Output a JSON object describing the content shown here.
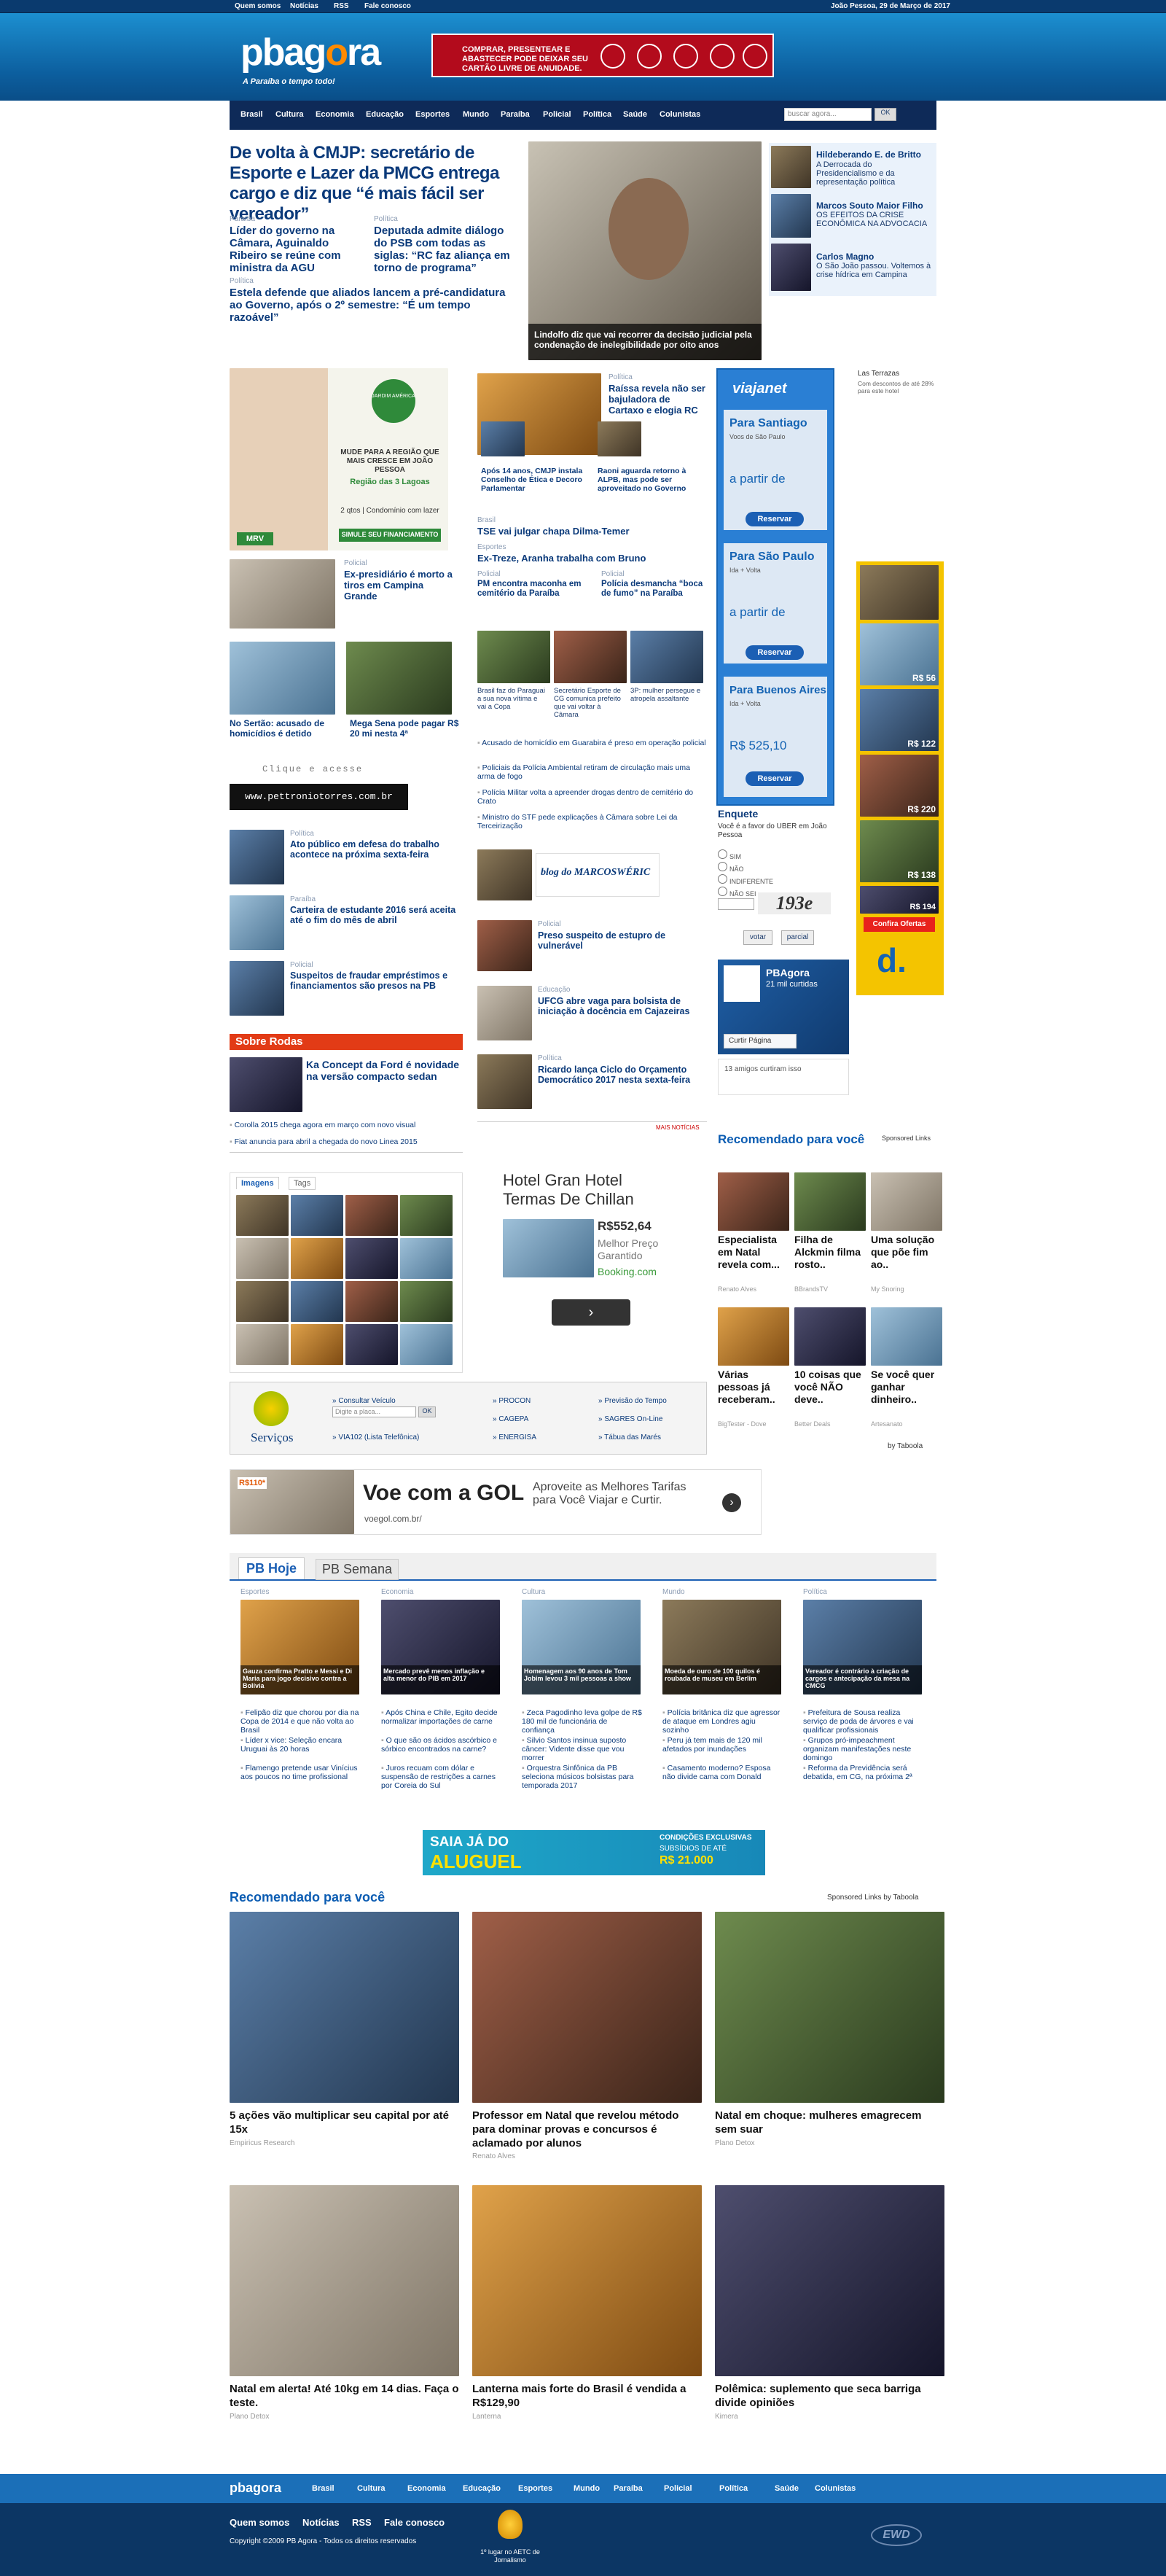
{
  "topbar": {
    "links": [
      "Quem somos",
      "Notícias",
      "RSS",
      "Fale conosco"
    ],
    "date": "João Pessoa, 29 de Março de 2017"
  },
  "header": {
    "logo_a": "pbag",
    "logo_o": "o",
    "logo_b": "ra",
    "slogan": "A Paraíba o tempo todo!",
    "ad_text": "COMPRAR, PRESENTEAR E ABASTECER PODE DEIXAR SEU CARTÃO LIVRE DE ANUIDADE."
  },
  "nav": {
    "items": [
      "Brasil",
      "Cultura",
      "Economia",
      "Educação",
      "Esportes",
      "Mundo",
      "Paraíba",
      "Policial",
      "Política",
      "Saúde",
      "Colunistas"
    ],
    "search_placeholder": "buscar agora...",
    "search_button": "OK"
  },
  "lead": {
    "headline": "De volta à CMJP: secretário de Esporte e Lazer da PMCG entrega cargo e diz que “é mais fácil ser vereador”",
    "sub1_kicker": "Paraíba",
    "sub1": "Líder do governo na Câmara, Aguinaldo Ribeiro se reúne com ministra da AGU",
    "sub2_kicker": "Política",
    "sub2": "Deputada admite diálogo do PSB com todas as siglas: “RC faz aliança em torno de programa”",
    "sub3_kicker": "Política",
    "sub3": "Estela defende que aliados lancem a pré-candidatura ao Governo, após o 2º semestre: “É um tempo razoável”",
    "photo_caption": "Lindolfo diz que vai recorrer da decisão judicial pela condenação de inelegibilidade por oito anos"
  },
  "columnists": [
    {
      "name": "Hildeberando E. de Britto",
      "text": "A Derrocada do Presidencialismo e da representação política"
    },
    {
      "name": "Marcos Souto Maior Filho",
      "text": "OS EFEITOS DA CRISE ECONÔMICA NA ADVOCACIA"
    },
    {
      "name": "Carlos Magno",
      "text": "O São João passou. Voltemos à crise hídrica em Campina"
    }
  ],
  "leftcol": {
    "mrv_ad": [
      "Residencial",
      "JARDIM AMÉRICA",
      "MUDE PARA A REGIÃO QUE MAIS CRESCE EM JOÃO PESSOA",
      "Região das 3 Lagoas",
      "2 qtos | Condomínio com lazer",
      "SIMULE SEU FINANCIAMENTO",
      "MRV"
    ],
    "n1_kicker": "Policial",
    "n1": "Ex-presidiário é morto a tiros em Campina Grande",
    "n2": "No Sertão: acusado de homicídios é detido",
    "n3": "Mega Sena pode pagar R$ 20 mi nesta 4ª",
    "click": "Clique e acesse",
    "site": "www.pettroniotorres.com.br",
    "n4_kicker": "Política",
    "n4": "Ato público em defesa do trabalho acontece na próxima sexta-feira",
    "n5_kicker": "Paraíba",
    "n5": "Carteira de estudante 2016 será aceita até o fim do mês de abril",
    "n6_kicker": "Policial",
    "n6": "Suspeitos de fraudar empréstimos e financiamentos são presos na PB",
    "rodas": "Sobre Rodas",
    "r1": "Ka Concept da Ford é novidade na versão compacto sedan",
    "r2": "Corolla 2015 chega agora em março com novo visual",
    "r3": "Fiat anuncia para abril a chegada do novo Linea 2015",
    "tabs": [
      "Imagens",
      "Tags"
    ]
  },
  "midcol": {
    "m1_kicker": "Política",
    "m1": "Raíssa revela não ser bajuladora de Cartaxo e elogia RC",
    "m2": "Após 14 anos, CMJP instala Conselho de Ética e Decoro Parlamentar",
    "m3": "Raoni aguarda retorno à ALPB, mas pode ser aproveitado no Governo",
    "m4_kicker": "Brasil",
    "m4": "TSE vai julgar chapa Dilma-Temer",
    "m5_kicker": "Esportes",
    "m5": "Ex-Treze, Aranha trabalha com Bruno",
    "m6_kicker": "Policial",
    "m6": "PM encontra maconha em cemitério da Paraíba",
    "m7_kicker": "Policial",
    "m7": "Polícia desmancha “boca de fumo” na Paraíba",
    "thumbs": [
      "Brasil faz do Paraguai a sua nova vítima e vai a Copa",
      "Secretário Esporte de CG comunica prefeito que vai voltar à Câmara",
      "3P: mulher persegue e atropela assaltante"
    ],
    "bullets": [
      "Acusado de homicídio em Guarabira é preso em operação policial",
      "Policiais da Polícia Ambiental retiram de circulação mais uma arma de fogo",
      "Polícia Militar volta a apreender drogas dentro de cemitério do Crato",
      "Ministro do STF pede explicações à Câmara sobre Lei da Terceirização"
    ],
    "blog": "blog do MARCOSWÉRIC",
    "b1_kicker": "Policial",
    "b1": "Preso suspeito de estupro de vulnerável",
    "b2_kicker": "Educação",
    "b2": "UFCG abre vaga para bolsista de iniciação à docência em Cajazeiras",
    "b3_kicker": "Política",
    "b3": "Ricardo lança Ciclo do Orçamento Democrático 2017 nesta sexta-feira",
    "more": "MAIS NOTÍCIAS",
    "hotel_title": "Hotel Gran Hotel Termas De Chillan",
    "hotel_price": "R$552,64",
    "hotel_sub": "Melhor Preço Garantido",
    "hotel_src": "Booking.com"
  },
  "viajanet": {
    "logo": "viajanet",
    "d1": "Para Santiago",
    "d1s": "Voos de São Paulo",
    "d1p": "a partir de",
    "d2": "Para São Paulo",
    "d2s": "Ida + Volta",
    "d2p": "a partir de",
    "d3": "Para Buenos Aires",
    "d3s": "Ida + Volta",
    "d3p": "R$ 525,10",
    "btn": "Reservar"
  },
  "poll": {
    "title": "Enquete",
    "q": "Você é a favor do UBER em João Pessoa",
    "opts": [
      "SIM",
      "NÃO",
      "INDIFERENTE",
      "NÃO SEI"
    ],
    "captcha": "193e",
    "vote": "votar",
    "partial": "parcial"
  },
  "fb": {
    "name": "PBAgora",
    "likes": "21 mil curtidas",
    "btn": "Curtir Página",
    "friends": "13 amigos curtiram isso"
  },
  "hotel_ad": {
    "title": "Las Terrazas",
    "text": "Com descontos de até 28% para este hotel"
  },
  "side_prices": [
    "R$ 56",
    "R$ 122",
    "R$ 220",
    "R$ 138",
    "R$ 194",
    "Confira Ofertas"
  ],
  "taboola_side": {
    "title": "Recomendado para você",
    "sponsored": "Sponsored Links",
    "by": "by Taboola",
    "items": [
      {
        "t": "Especialista em Natal revela com...",
        "s": "Renato Alves"
      },
      {
        "t": "Filha de Alckmin filma rosto..",
        "s": "BBrandsTV"
      },
      {
        "t": "Uma solução que põe fim ao..",
        "s": "My Snoring"
      },
      {
        "t": "Várias pessoas já receberam..",
        "s": "BigTester - Dove"
      },
      {
        "t": "10 coisas que você NÃO deve..",
        "s": "Better Deals"
      },
      {
        "t": "Se você quer ganhar dinheiro..",
        "s": "Artesanato"
      }
    ]
  },
  "services": {
    "title": "Serviços",
    "field": "Digite a placa...",
    "ok": "OK",
    "consult": "» Consultar Veículo",
    "links": [
      "» PROCON",
      "» CAGEPA",
      "» ENERGISA",
      "» Previsão do Tempo",
      "» SAGRES On-Line",
      "» Tábua das Marés",
      "» VIA102 (Lista Telefônica)"
    ]
  },
  "gol_ad": {
    "big": "Voe com a GOL",
    "url": "voegol.com.br/",
    "text": "Aproveite as Melhores Tarifas para Você Viajar e Curtir.",
    "price": "R$110*"
  },
  "pbtabs": {
    "tabs": [
      "PB Hoje",
      "PB Semana"
    ],
    "cols": [
      {
        "k": "Esportes",
        "cap": "Gauza confirma Pratto e Messi e Di Maria para jogo decisivo contra a Bolívia",
        "items": [
          "Felipão diz que chorou por dia na Copa de 2014 e que não volta ao Brasil",
          "Líder x vice: Seleção encara Uruguai às 20 horas",
          "Flamengo pretende usar Vinícius aos poucos no time profissional"
        ]
      },
      {
        "k": "Economia",
        "cap": "Mercado prevê menos inflação e alta menor do PIB em 2017",
        "items": [
          "Após China e Chile, Egito decide normalizar importações de carne",
          "O que são os ácidos ascórbico e sórbico encontrados na carne?",
          "Juros recuam com dólar e suspensão de restrições a carnes por Coreia do Sul"
        ]
      },
      {
        "k": "Cultura",
        "cap": "Homenagem aos 90 anos de Tom Jobim levou 3 mil pessoas a show",
        "items": [
          "Zeca Pagodinho leva golpe de R$ 180 mil de funcionária de confiança",
          "Silvio Santos insinua suposto câncer: Vidente disse que vou morrer",
          "Orquestra Sinfônica da PB seleciona músicos bolsistas para temporada 2017"
        ]
      },
      {
        "k": "Mundo",
        "cap": "Moeda de ouro de 100 quilos é roubada de museu em Berlim",
        "items": [
          "Polícia britânica diz que agressor de ataque em Londres agiu sozinho",
          "Peru já tem mais de 120 mil afetados por inundações",
          "Casamento moderno? Esposa não divide cama com Donald"
        ]
      },
      {
        "k": "Política",
        "cap": "Vereador é contrário à criação de cargos e antecipação da mesa na CMCG",
        "items": [
          "Prefeitura de Sousa realiza serviço de poda de árvores e vai qualificar profissionais",
          "Grupos pró-impeachment organizam manifestações neste domingo",
          "Reforma da Previdência será debatida, em CG, na próxima 2ª"
        ]
      }
    ]
  },
  "aluguel_ad": {
    "a": "SAIA JÁ DO",
    "b": "ALUGUEL",
    "c": "CONDIÇÕES EXCLUSIVAS",
    "d": "SUBSÍDIOS DE ATÉ",
    "e": "R$ 21.000"
  },
  "taboola_big": {
    "title": "Recomendado para você",
    "sponsored": "Sponsored Links by Taboola",
    "items": [
      {
        "t": "5 ações vão multiplicar seu capital por até 15x",
        "s": "Empiricus Research"
      },
      {
        "t": "Professor em Natal que revelou método para dominar provas e concursos é aclamado por alunos",
        "s": "Renato Alves"
      },
      {
        "t": "Natal em choque: mulheres emagrecem sem suar",
        "s": "Plano Detox"
      },
      {
        "t": "Natal em alerta! Até 10kg em 14 dias. Faça o teste.",
        "s": "Plano Detox"
      },
      {
        "t": "Lanterna mais forte do Brasil é vendida a R$129,90",
        "s": "Lanterna"
      },
      {
        "t": "Polêmica: suplemento que seca barriga divide opiniões",
        "s": "Kimera"
      }
    ]
  },
  "footer": {
    "logo": "pbagora",
    "nav": [
      "Brasil",
      "Cultura",
      "Economia",
      "Educação",
      "Esportes",
      "Mundo",
      "Paraíba",
      "Policial",
      "Política",
      "Saúde",
      "Colunistas"
    ],
    "links": [
      "Quem somos",
      "Notícias",
      "RSS",
      "Fale conosco"
    ],
    "copyright": "Copyright ©2009 PB Agora - Todos os direitos reservados",
    "award": "1º lugar no AETC de Jornalismo",
    "dev": "EWD"
  }
}
